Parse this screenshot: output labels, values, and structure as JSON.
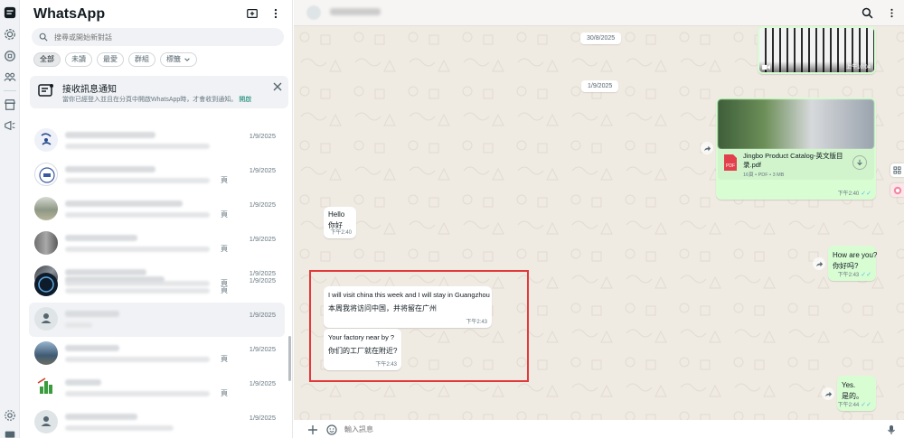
{
  "app": {
    "title": "WhatsApp",
    "search_placeholder": "搜尋或開始新對話"
  },
  "filters": [
    {
      "label": "全部"
    },
    {
      "label": "未讀"
    },
    {
      "label": "最愛"
    },
    {
      "label": "群組"
    },
    {
      "label": "標籤"
    }
  ],
  "notification": {
    "title": "接收訊息通知",
    "text": "當你已經登入並且在分頁中開啟WhatsApp時，才會收到通知。",
    "link": "開啟"
  },
  "chats": [
    {
      "time": "1/9/2025",
      "preview_tail": "",
      "avatar": "logo-blue"
    },
    {
      "time": "1/9/2025",
      "preview_tail": "頁",
      "avatar": "logo-badge"
    },
    {
      "time": "1/9/2025",
      "preview_tail": "頁",
      "avatar": "photo-factory"
    },
    {
      "time": "1/9/2025",
      "preview_tail": "頁",
      "avatar": "photo-gray"
    },
    {
      "time": "1/9/2025",
      "preview_tail": "頁",
      "avatar": "photo-dark"
    },
    {
      "time": "1/9/2025",
      "preview_tail": "頁",
      "avatar": "logo-circle"
    },
    {
      "time": "1/9/2025",
      "preview_tail": "",
      "avatar": "default-person"
    },
    {
      "time": "1/9/2025",
      "preview_tail": "頁",
      "avatar": "photo-street"
    },
    {
      "time": "1/9/2025",
      "preview_tail": "頁",
      "avatar": "logo-green"
    },
    {
      "time": "1/9/2025",
      "preview_tail": "",
      "avatar": "default-person"
    }
  ],
  "conversation": {
    "dates": [
      "30/8/2025",
      "1/9/2025"
    ],
    "video_time": "上午10:04",
    "file": {
      "name_line1": "Jingbo Product Catalog-英文版目",
      "name_line2": "录.pdf",
      "meta": "16頁 • PDF • 3 MB",
      "time": "下午2:40"
    },
    "messages": [
      {
        "dir": "in",
        "lines": [
          "Hello",
          "你好"
        ],
        "time": "下午2:40"
      },
      {
        "dir": "out",
        "lines": [
          "How are you?",
          "你好吗?"
        ],
        "time": "下午2:43"
      },
      {
        "dir": "in",
        "lines": [
          "I will visit china this week and I will stay in Guangzhou",
          "本周我将访问中国，并将留在广州"
        ],
        "time": "下午2:43"
      },
      {
        "dir": "in",
        "lines": [
          "Your factory near by ?",
          "你们的工厂就在附近?"
        ],
        "time": "下午2:43"
      },
      {
        "dir": "out",
        "lines": [
          "Yes.",
          "是的。"
        ],
        "time": "下午2:44"
      }
    ],
    "composer_placeholder": "輸入訊息"
  },
  "colors": {
    "accent": "#008069",
    "outgoing_bubble": "#d9fdd3",
    "chat_background": "#efeae2",
    "read_ticks": "#53bdeb",
    "highlight": "#e23a3a"
  }
}
